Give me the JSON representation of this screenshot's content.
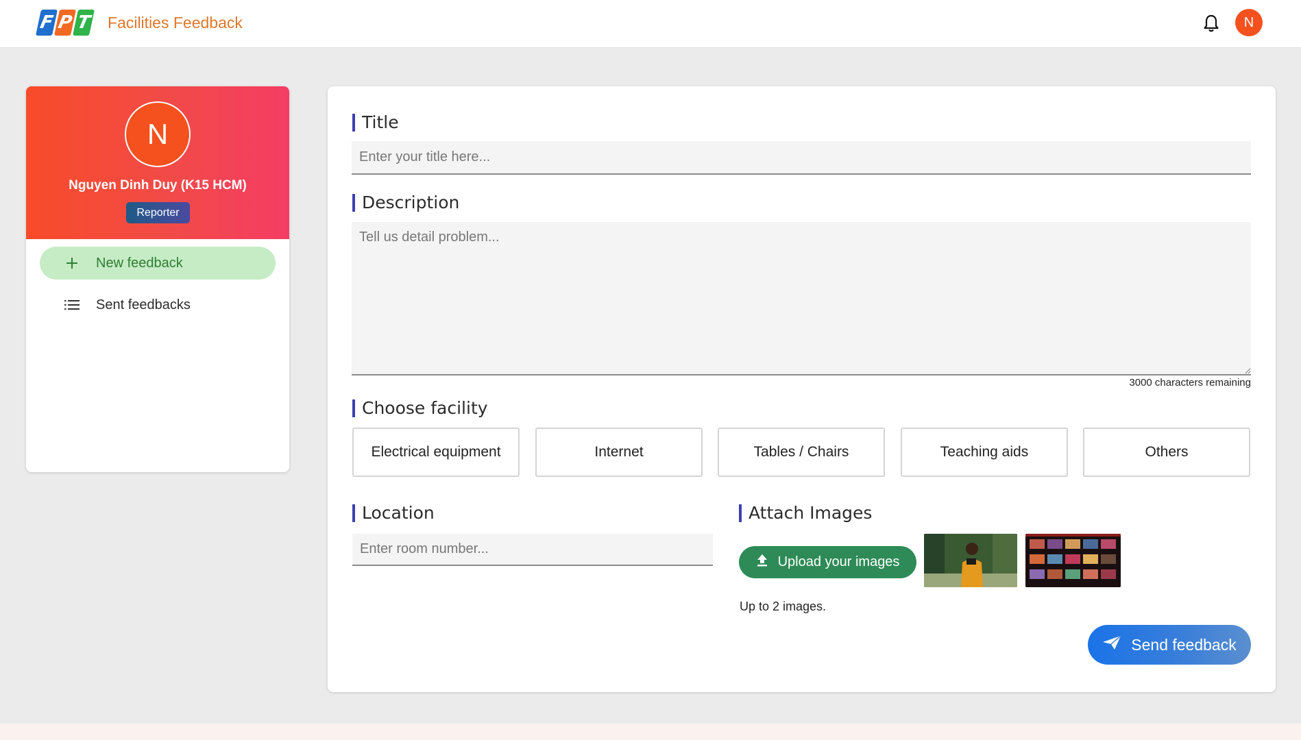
{
  "header": {
    "logo_letters": [
      "F",
      "P",
      "T"
    ],
    "app_title": "Facilities Feedback",
    "avatar_initial": "N",
    "icons": {
      "notification": "bell-icon"
    }
  },
  "sidebar": {
    "avatar_initial": "N",
    "user_name": "Nguyen Dinh Duy (K15 HCM)",
    "role": "Reporter",
    "items": [
      {
        "label": "New feedback",
        "icon": "plus-icon",
        "active": true
      },
      {
        "label": "Sent feedbacks",
        "icon": "list-icon",
        "active": false
      }
    ]
  },
  "form": {
    "title": {
      "label": "Title",
      "placeholder": "Enter your title here...",
      "value": ""
    },
    "description": {
      "label": "Description",
      "placeholder": "Tell us detail problem...",
      "value": "",
      "remaining": "3000 characters remaining"
    },
    "facility": {
      "label": "Choose facility",
      "options": [
        "Electrical equipment",
        "Internet",
        "Tables / Chairs",
        "Teaching aids",
        "Others"
      ]
    },
    "location": {
      "label": "Location",
      "placeholder": "Enter room number...",
      "value": ""
    },
    "images": {
      "label": "Attach Images",
      "upload_label": "Upload your images",
      "note": "Up to 2 images.",
      "thumbnails": [
        "photo-thumbnail",
        "screenshot-thumbnail"
      ]
    },
    "submit_label": "Send feedback"
  },
  "colors": {
    "brand_orange": "#e0772b",
    "avatar": "#f4511e",
    "active_nav_bg": "#c6ecc6",
    "upload_green": "#2e8b57",
    "send_blue": "#1a73e8",
    "section_accent": "#3f3fb0"
  }
}
